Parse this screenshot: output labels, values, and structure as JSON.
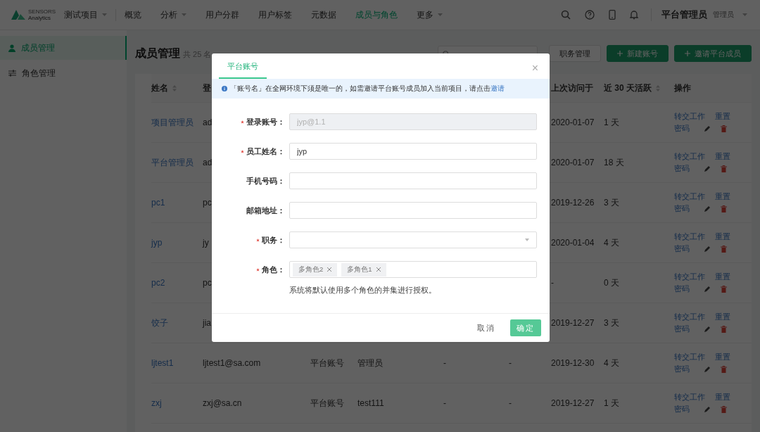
{
  "nav": {
    "logo_top": "SENSORS",
    "logo_bottom": "Analytics",
    "project": "测试项目",
    "items": [
      {
        "label": "概览",
        "selected": false,
        "dropdown": false
      },
      {
        "label": "分析",
        "selected": false,
        "dropdown": true
      },
      {
        "label": "用户分群",
        "selected": false,
        "dropdown": false
      },
      {
        "label": "用户标签",
        "selected": false,
        "dropdown": false
      },
      {
        "label": "元数据",
        "selected": false,
        "dropdown": false
      },
      {
        "label": "成员与角色",
        "selected": true,
        "dropdown": false
      },
      {
        "label": "更多",
        "selected": false,
        "dropdown": true
      }
    ],
    "user": "平台管理员",
    "role": "管理员"
  },
  "sidebar": {
    "items": [
      {
        "label": "成员管理",
        "kind": "member",
        "selected": true
      },
      {
        "label": "角色管理",
        "kind": "role",
        "selected": false
      }
    ]
  },
  "page": {
    "title": "成员管理",
    "count": "共 25 名",
    "buttons": [
      {
        "label": "职务管理",
        "kind": "plain"
      },
      {
        "label": "新建账号",
        "kind": "add"
      },
      {
        "label": "邀请平台成员",
        "kind": "add"
      }
    ]
  },
  "table": {
    "columns": [
      {
        "label": "姓名",
        "sortable": true
      },
      {
        "label": "登"
      },
      {
        "label": "上次访问于",
        "sortable": false
      },
      {
        "label": "近 30 天活跃",
        "sortable": true
      },
      {
        "label": "操作",
        "sortable": false
      }
    ],
    "rows": [
      {
        "name": "项目管理员",
        "login": "ad",
        "last_visit": "2020-01-07",
        "active": "1 天",
        "actions": [
          "转交工作",
          "重置",
          "密码"
        ]
      },
      {
        "name": "平台管理员",
        "login": "ad",
        "last_visit": "2020-01-07",
        "active": "18 天",
        "actions": [
          "转交工作",
          "重置",
          "密码"
        ]
      },
      {
        "name": "pc1",
        "login": "pc",
        "last_visit": "2019-12-26",
        "active": "3 天",
        "actions": [
          "转交工作",
          "重置",
          "密码"
        ]
      },
      {
        "name": "jyp",
        "login": "jy",
        "last_visit": "2020-01-04",
        "active": "4 天",
        "actions": [
          "转交工作",
          "重置",
          "密码"
        ]
      },
      {
        "name": "pc2",
        "login": "pc",
        "last_visit": "-",
        "active": "0 天",
        "actions": [
          "转交工作",
          "重置",
          "密码"
        ]
      },
      {
        "name": "饺子",
        "login": "jia",
        "last_visit": "2019-12-27",
        "active": "3 天",
        "actions": [
          "转交工作",
          "重置",
          "密码"
        ]
      },
      {
        "name": "ljtest1",
        "login": "ljtest1@sa.com",
        "type": "平台账号",
        "role": "管理员",
        "col5": "-",
        "col6": "-",
        "last_visit": "2019-12-30",
        "active": "4 天",
        "actions": [
          "转交工作",
          "重置",
          "密码"
        ]
      },
      {
        "name": "zxj",
        "login": "zxj@sa.cn",
        "type": "平台账号",
        "role": "test111",
        "col5": "-",
        "col6": "-",
        "last_visit": "2019-12-27",
        "active": "1 天",
        "actions": [
          "转交工作",
          "重置",
          "密码"
        ]
      }
    ]
  },
  "dialog": {
    "tab": {
      "label": "平台账号",
      "selected": true
    },
    "close": "×",
    "notice": {
      "text": "「账号名」在全网环境下须是唯一的，如需邀请平台账号成员加入当前项目，请点击",
      "link": "邀请"
    },
    "fields": [
      {
        "label": "登录账号：",
        "required": true,
        "kind": "text",
        "value": "jyp@1.1",
        "disabled": true
      },
      {
        "label": "员工姓名：",
        "required": true,
        "kind": "text",
        "value": "jyp",
        "disabled": false
      },
      {
        "label": "手机号码：",
        "required": false,
        "kind": "text",
        "disabled": false
      },
      {
        "label": "邮箱地址：",
        "required": false,
        "kind": "text",
        "disabled": false
      },
      {
        "label": "职务：",
        "required": true,
        "kind": "select"
      },
      {
        "label": "角色：",
        "required": true,
        "kind": "tags",
        "tags": [
          "多角色2",
          "多角色1"
        ],
        "hint": "系统将默认使用多个角色的并集进行授权。"
      }
    ],
    "buttons": [
      {
        "label": "取消",
        "kind": "cancel"
      },
      {
        "label": "确定",
        "kind": "primary"
      }
    ]
  }
}
